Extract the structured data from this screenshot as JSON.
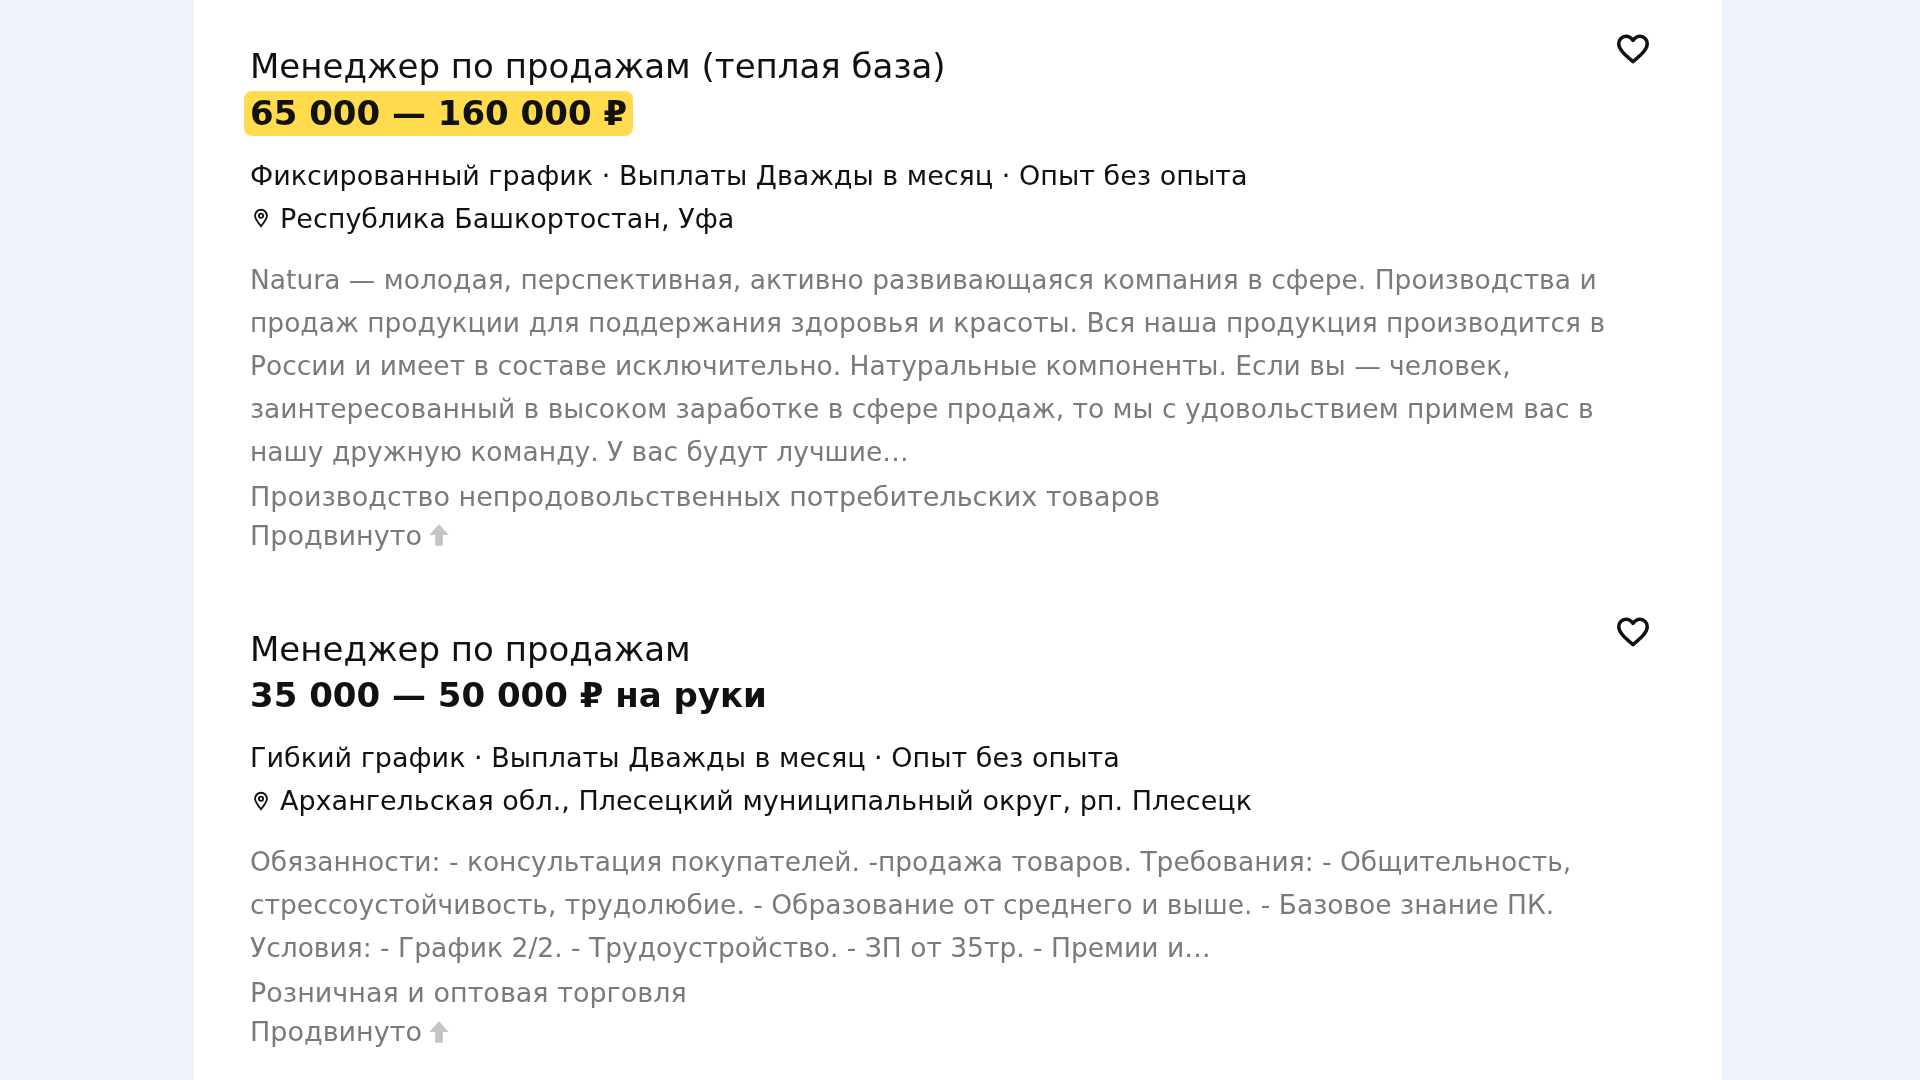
{
  "vacancies": [
    {
      "title": "Менеджер по продажам (теплая база)",
      "salary": "65 000 — 160 000 ₽",
      "salary_highlighted": true,
      "tags": "Фиксированный график · Выплаты Дважды в месяц · Опыт без опыта",
      "location": "Республика Башкортостан, Уфа",
      "description": "Natura — молодая, перспективная, активно развивающаяся компания в сфере. Производства и продаж продукции для поддержания здоровья и красоты. Вся наша продукция производится в России и имеет в составе исключительно. Натуральные компоненты. Если вы — человек, заинтересованный в высоком заработке в сфере продаж, то мы с удовольствием примем вас в нашу дружную команду. У вас будут лучшие…",
      "industry": "Производство непродовольственных потребительских товаров",
      "promoted": "Продвинуто"
    },
    {
      "title": "Менеджер по продажам",
      "salary": "35 000 — 50 000 ₽ на руки",
      "salary_highlighted": false,
      "tags": "Гибкий график · Выплаты Дважды в месяц · Опыт без опыта",
      "location": "Архангельская обл., Плесецкий муниципальный округ, рп. Плесецк",
      "description": "Обязанности: - консультация покупателей. -продажа товаров. Требования: - Общительность, стрессоустойчивость, трудолюбие. - Образование от среднего и выше. - Базовое знание ПК. Условия: - График 2/2. - Трудоустройство. - ЗП от 35тр. - Премии и…",
      "industry": "Розничная и оптовая торговля",
      "promoted": "Продвинуто"
    }
  ]
}
